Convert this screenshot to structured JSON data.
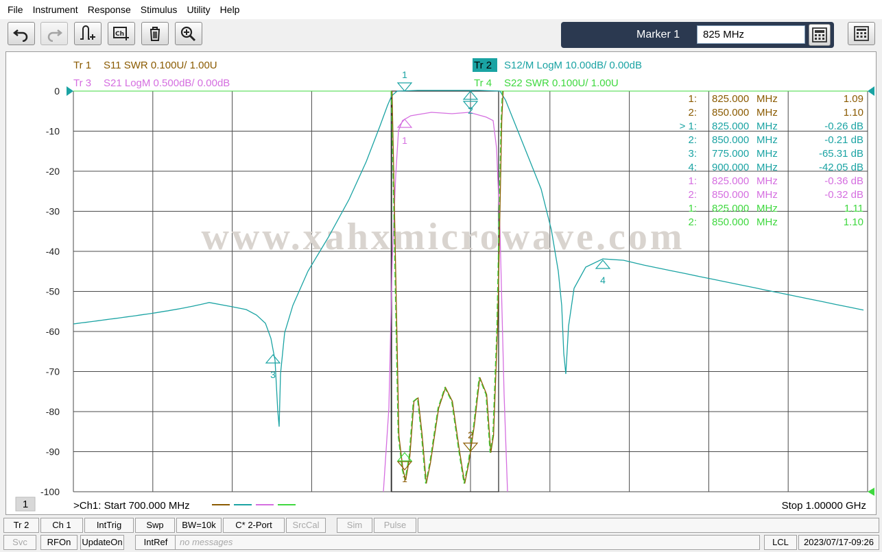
{
  "menu": [
    "File",
    "Instrument",
    "Response",
    "Stimulus",
    "Utility",
    "Help"
  ],
  "toolbar": {
    "buttons": [
      "undo-icon",
      "redo-icon",
      "add-trace-icon",
      "add-channel-icon",
      "delete-icon",
      "zoom-icon"
    ],
    "marker_label": "Marker 1",
    "marker_value": "825 MHz",
    "calculator_icon": "calculator-icon",
    "keypad_icon": "keypad-icon"
  },
  "traces": [
    {
      "id": "Tr  1",
      "text": "S11 SWR 0.100U/  1.00U",
      "color": "#8a5a00"
    },
    {
      "id": "Tr  2",
      "text": "S12/M LogM 10.00dB/  0.00dB",
      "color": "#1aa3a3",
      "active": true
    },
    {
      "id": "Tr  3",
      "text": "S21 LogM 0.500dB/  0.00dB",
      "color": "#d56ee0"
    },
    {
      "id": "Tr  4",
      "text": "S22 SWR 0.100U/  1.00U",
      "color": "#3fd83f"
    }
  ],
  "watermark": "www.xahxmicrowave.com",
  "y_ticks": [
    "0",
    "-10",
    "-20",
    "-30",
    "-40",
    "-50",
    "-60",
    "-70",
    "-80",
    "-90",
    "-100"
  ],
  "markers_table": [
    {
      "idx": "1:",
      "freq": "825.000",
      "unit": "MHz",
      "val": "1.09",
      "color": "#8a5a00"
    },
    {
      "idx": "2:",
      "freq": "850.000",
      "unit": "MHz",
      "val": "1.10",
      "color": "#8a5a00"
    },
    {
      "idx": "> 1:",
      "freq": "825.000",
      "unit": "MHz",
      "val": "-0.26 dB",
      "color": "#1aa3a3"
    },
    {
      "idx": "2:",
      "freq": "850.000",
      "unit": "MHz",
      "val": "-0.21 dB",
      "color": "#1aa3a3"
    },
    {
      "idx": "3:",
      "freq": "775.000",
      "unit": "MHz",
      "val": "-65.31 dB",
      "color": "#1aa3a3"
    },
    {
      "idx": "4:",
      "freq": "900.000",
      "unit": "MHz",
      "val": "-42.05 dB",
      "color": "#1aa3a3"
    },
    {
      "idx": "1:",
      "freq": "825.000",
      "unit": "MHz",
      "val": "-0.36 dB",
      "color": "#d56ee0"
    },
    {
      "idx": "2:",
      "freq": "850.000",
      "unit": "MHz",
      "val": "-0.32 dB",
      "color": "#d56ee0"
    },
    {
      "idx": "1:",
      "freq": "825.000",
      "unit": "MHz",
      "val": "1.11",
      "color": "#3fd83f"
    },
    {
      "idx": "2:",
      "freq": "850.000",
      "unit": "MHz",
      "val": "1.10",
      "color": "#3fd83f"
    }
  ],
  "marker_labels": {
    "m1": "1",
    "m2": "2",
    "m3": "3",
    "m4": "4"
  },
  "footer": {
    "channel_number": "1",
    "start": ">Ch1:  Start  700.000 MHz",
    "stop": "Stop  1.00000 GHz"
  },
  "status1": [
    {
      "label": "Tr 2",
      "dim": false
    },
    {
      "label": "Ch 1",
      "dim": false
    },
    {
      "label": "IntTrig",
      "dim": false
    },
    {
      "label": "Swp",
      "dim": false
    },
    {
      "label": "BW=10k",
      "dim": false
    },
    {
      "label": "C* 2-Port",
      "dim": false
    },
    {
      "label": "SrcCal",
      "dim": true
    },
    {
      "label": "Sim",
      "dim": true
    },
    {
      "label": "Pulse",
      "dim": true
    }
  ],
  "status2": [
    {
      "label": "Svc",
      "dim": true
    },
    {
      "label": "RFOn",
      "dim": false
    },
    {
      "label": "UpdateOn",
      "dim": false
    },
    {
      "label": "IntRef",
      "dim": false
    },
    {
      "label": "no messages",
      "dim": true
    },
    {
      "label": "LCL",
      "dim": false
    },
    {
      "label": "2023/07/17-09:26",
      "dim": false
    }
  ],
  "chart_data": {
    "type": "line",
    "x_range_mhz": [
      700,
      1000
    ],
    "y_range_db": [
      -100,
      0
    ],
    "grid": true,
    "series": [
      {
        "name": "Tr 2 S12/M LogM",
        "x_mhz": [
          700,
          740,
          760,
          770,
          775,
          778,
          785,
          800,
          810,
          813,
          815,
          825,
          850,
          853,
          856,
          860,
          880,
          895,
          900,
          930,
          960,
          1000
        ],
        "y_db": [
          -58,
          -54.5,
          -54,
          -58,
          -65.3,
          -70,
          -45,
          -30,
          -12,
          -3,
          0,
          -0.26,
          -0.21,
          0,
          -1,
          -15,
          -45,
          -70,
          -42.05,
          -44,
          -50,
          -53
        ]
      }
    ]
  }
}
